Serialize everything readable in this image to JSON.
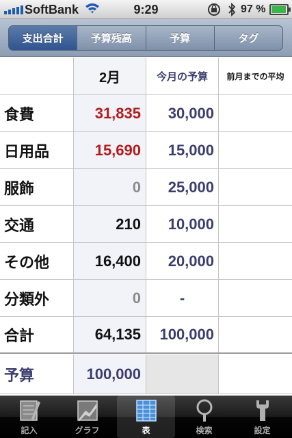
{
  "status": {
    "carrier": "SoftBank",
    "time": "9:29",
    "battery_pct": "97 %",
    "battery_level": 0.97
  },
  "segments": [
    {
      "label": "支出合計",
      "active": true
    },
    {
      "label": "予算残高",
      "active": false
    },
    {
      "label": "予算",
      "active": false
    },
    {
      "label": "タグ",
      "active": false
    }
  ],
  "table": {
    "header": {
      "month": "2月",
      "budget": "今月の予算",
      "avg": "前月までの平均"
    },
    "rows": [
      {
        "label": "食費",
        "month": "31,835",
        "budget": "30,000",
        "month_color": "red"
      },
      {
        "label": "日用品",
        "month": "15,690",
        "budget": "15,000",
        "month_color": "red"
      },
      {
        "label": "服飾",
        "month": "0",
        "budget": "25,000",
        "month_color": "gray"
      },
      {
        "label": "交通",
        "month": "210",
        "budget": "10,000",
        "month_color": "black"
      },
      {
        "label": "その他",
        "month": "16,400",
        "budget": "20,000",
        "month_color": "black"
      },
      {
        "label": "分類外",
        "month": "0",
        "budget": "-",
        "month_color": "gray"
      },
      {
        "label": "合計",
        "month": "64,135",
        "budget": "100,000",
        "month_color": "black"
      },
      {
        "label": "予算",
        "month": "100,000",
        "budget": "",
        "month_color": "navy"
      }
    ]
  },
  "tabs": [
    {
      "label": "記入",
      "icon": "notebook-pencil-icon",
      "active": false
    },
    {
      "label": "グラフ",
      "icon": "graph-icon",
      "active": false
    },
    {
      "label": "表",
      "icon": "table-icon",
      "active": true
    },
    {
      "label": "検索",
      "icon": "magnifier-icon",
      "active": false
    },
    {
      "label": "設定",
      "icon": "wrench-icon",
      "active": false
    }
  ],
  "colors": {
    "over_budget": "#b11c1c",
    "budget_text": "#3b3d6e",
    "segment_active": "#2f5490"
  }
}
